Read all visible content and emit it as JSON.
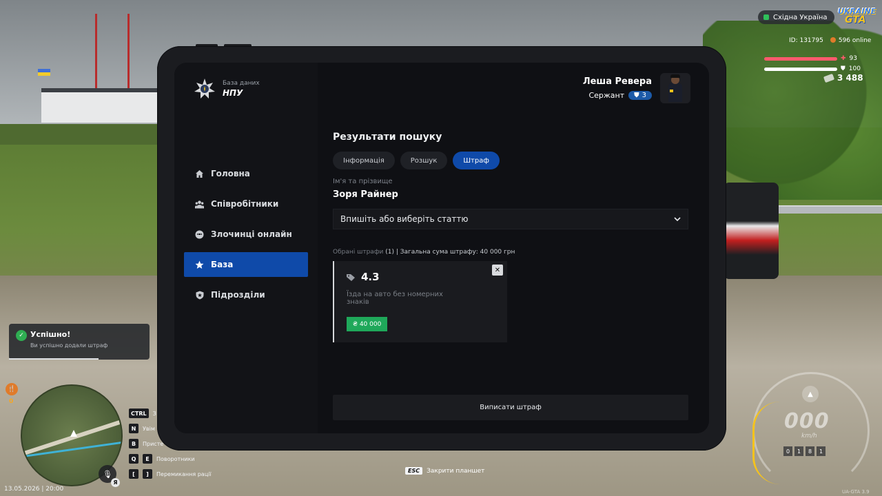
{
  "hud": {
    "server": "Східна Україна",
    "logo_line1": "UKRAINE",
    "logo_line2": "GTA",
    "player_id": "ID: 131795",
    "online": "596 online",
    "health": "93",
    "armor": "100",
    "money": "3 488",
    "hunger_value": "0",
    "datetime": "13.05.2026 | 20:00",
    "mic_lang": "Я",
    "version": "UA-GTA 3.9"
  },
  "keys": [
    {
      "key": "CTRL",
      "label": "З"
    },
    {
      "key": "N",
      "label": "Увім"
    },
    {
      "key": "B",
      "label": "Присте"
    },
    {
      "key": "Q",
      "key2": "E",
      "label": "Поворотники"
    },
    {
      "key": "[",
      "key2": "]",
      "label": "Перемикання рації"
    }
  ],
  "esc_hint": {
    "key": "ESC",
    "label": "Закрити планшет"
  },
  "speedometer": {
    "speed": "000",
    "unit": "km/h",
    "odometer": [
      "0",
      "1",
      "8",
      "1"
    ]
  },
  "notification": {
    "title": "Успішно!",
    "text": "Ви успішно додали штраф"
  },
  "tablet": {
    "brand_sub": "База даних",
    "brand_main": "НПУ",
    "user_name": "Леша Ревера",
    "user_rank": "Сержант",
    "user_rank_level": "3",
    "nav": [
      {
        "label": "Головна",
        "icon": "home-icon",
        "active": false
      },
      {
        "label": "Співробітники",
        "icon": "users-icon",
        "active": false
      },
      {
        "label": "Злочинці онлайн",
        "icon": "criminal-icon",
        "active": false
      },
      {
        "label": "База",
        "icon": "star-icon",
        "active": true
      },
      {
        "label": "Підрозділи",
        "icon": "shield-icon",
        "active": false
      }
    ],
    "page_title": "Результати пошуку",
    "tabs": [
      {
        "label": "Інформація",
        "active": false
      },
      {
        "label": "Розшук",
        "active": false
      },
      {
        "label": "Штраф",
        "active": true
      }
    ],
    "name_label": "Ім'я та прізвище",
    "person_name": "Зоря Райнер",
    "article_placeholder": "Впишіть або виберіть статтю",
    "summary_prefix": "Обрані штрафи",
    "summary_count": "(1)",
    "summary_total": "| Загальна сума штрафу: 40 000 грн",
    "fine": {
      "code": "4.3",
      "description": "Їзда на авто без номерних знаків",
      "amount": "₴ 40 000"
    },
    "submit_label": "Виписати штраф"
  },
  "colors": {
    "accent": "#0f4aa9",
    "success": "#1fa85a",
    "panel": "#0f1014"
  }
}
